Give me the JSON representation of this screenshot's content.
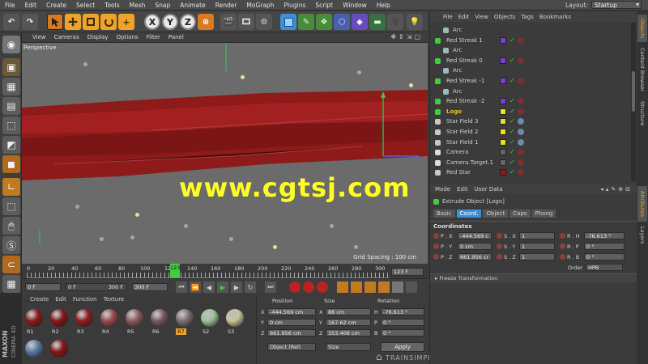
{
  "menubar": {
    "items": [
      "File",
      "Edit",
      "Create",
      "Select",
      "Tools",
      "Mesh",
      "Snap",
      "Animate",
      "Render",
      "MoGraph",
      "Plugins",
      "Script",
      "Window",
      "Help"
    ],
    "layout_label": "Layout:",
    "layout_value": "Startup"
  },
  "toolbar": {
    "axis_x": "X",
    "axis_y": "Y",
    "axis_z": "Z"
  },
  "viewport": {
    "menu": [
      "View",
      "Cameras",
      "Display",
      "Options",
      "Filter",
      "Panel"
    ],
    "label": "Perspective",
    "grid_spacing": "Grid Spacing : 100 cm",
    "watermark": "www.cgtsj.com"
  },
  "timeline": {
    "ticks": [
      "0",
      "20",
      "40",
      "60",
      "80",
      "100",
      "12",
      "140",
      "160",
      "180",
      "200",
      "220",
      "240",
      "260",
      "280",
      "300"
    ],
    "current": "123",
    "current_frame": "123 F"
  },
  "transport": {
    "start": "0 F",
    "preview_start": "0 F",
    "preview_end": "300 F",
    "end": "300 F"
  },
  "materials": {
    "menu": [
      "Create",
      "Edit",
      "Function",
      "Texture"
    ],
    "items": [
      {
        "name": "R1",
        "color": "#8e1a1c"
      },
      {
        "name": "R2",
        "color": "#8a1518"
      },
      {
        "name": "R3",
        "color": "#921c20"
      },
      {
        "name": "R4",
        "color": "#9a4a50"
      },
      {
        "name": "R5",
        "color": "#8a5c62"
      },
      {
        "name": "R6",
        "color": "#7a5a5c"
      },
      {
        "name": "R7",
        "color": "#7c7070"
      },
      {
        "name": "S2",
        "color": "#9cc29a"
      },
      {
        "name": "S3",
        "color": "#c9c49a"
      }
    ],
    "selected": "R7"
  },
  "coords": {
    "headers": [
      "Position",
      "Size",
      "Rotation"
    ],
    "rows": [
      {
        "axis": "X",
        "pos": "-444.569 cm",
        "size_axis": "X",
        "size": "88 cm",
        "rot_axis": "H",
        "rot": "-76.613 °"
      },
      {
        "axis": "Y",
        "pos": "0 cm",
        "size_axis": "Y",
        "size": "167.62 cm",
        "rot_axis": "P",
        "rot": "0 °"
      },
      {
        "axis": "Z",
        "pos": "661.956 cm",
        "size_axis": "Z",
        "size": "353.408 cm",
        "rot_axis": "B",
        "rot": "0 °"
      }
    ],
    "mode": "Object (Rel)",
    "size_mode": "Size",
    "apply": "Apply"
  },
  "brand": {
    "line1": "MAXON",
    "line2": "CINEMA 4D"
  },
  "objects": {
    "menu": [
      "File",
      "Edit",
      "View",
      "Objects",
      "Tags",
      "Bookmarks"
    ],
    "rows": [
      {
        "name": "Arc",
        "indent": 2,
        "kind": "arc"
      },
      {
        "name": "Red Streak 1",
        "indent": 1,
        "kind": "streak"
      },
      {
        "name": "Arc",
        "indent": 2,
        "kind": "arc"
      },
      {
        "name": "Red Streak 0",
        "indent": 1,
        "kind": "streak"
      },
      {
        "name": "Arc",
        "indent": 2,
        "kind": "arc"
      },
      {
        "name": "Red Streak -1",
        "indent": 1,
        "kind": "streak"
      },
      {
        "name": "Arc",
        "indent": 2,
        "kind": "arc"
      },
      {
        "name": "Red Streak -2",
        "indent": 1,
        "kind": "streak"
      },
      {
        "name": "Logo",
        "indent": 1,
        "kind": "logo"
      },
      {
        "name": "Star Field 3",
        "indent": 1,
        "kind": "star"
      },
      {
        "name": "Star Field 2",
        "indent": 1,
        "kind": "star"
      },
      {
        "name": "Star Field 1",
        "indent": 1,
        "kind": "star"
      },
      {
        "name": "Camera",
        "indent": 1,
        "kind": "camera"
      },
      {
        "name": "Camera.Target.1",
        "indent": 1,
        "kind": "target"
      },
      {
        "name": "Red Star",
        "indent": 1,
        "kind": "star2"
      }
    ]
  },
  "attributes": {
    "menu": [
      "Mode",
      "Edit",
      "User Data"
    ],
    "object_title": "Extrude Object [Logo]",
    "tabs": [
      "Basic",
      "Coord.",
      "Object",
      "Caps",
      "Phong"
    ],
    "active_tab": "Coord.",
    "section": "Coordinates",
    "rows": [
      {
        "p": "P . X",
        "pv": "-444.569 c",
        "s": "S . X",
        "sv": "1",
        "r": "R . H",
        "rv": "-76.613 °"
      },
      {
        "p": "P . Y",
        "pv": "0 cm",
        "s": "S . Y",
        "sv": "1",
        "r": "R . P",
        "rv": "0 °"
      },
      {
        "p": "P . Z",
        "pv": "661.956 cr",
        "s": "S . Z",
        "sv": "1",
        "r": "R . B",
        "rv": "0 °"
      }
    ],
    "order_label": "Order",
    "order_value": "HPB",
    "freeze": "Freeze Transformation"
  },
  "right_tabs": [
    "Objects",
    "Content Browser",
    "Structure",
    "Attributes",
    "Layers"
  ],
  "trainsimple": "TRAINSIMPLE",
  "colors": {
    "accent": "#3d8fd6",
    "watermark": "#ffff22",
    "active_frame": "#3ecf3e"
  }
}
